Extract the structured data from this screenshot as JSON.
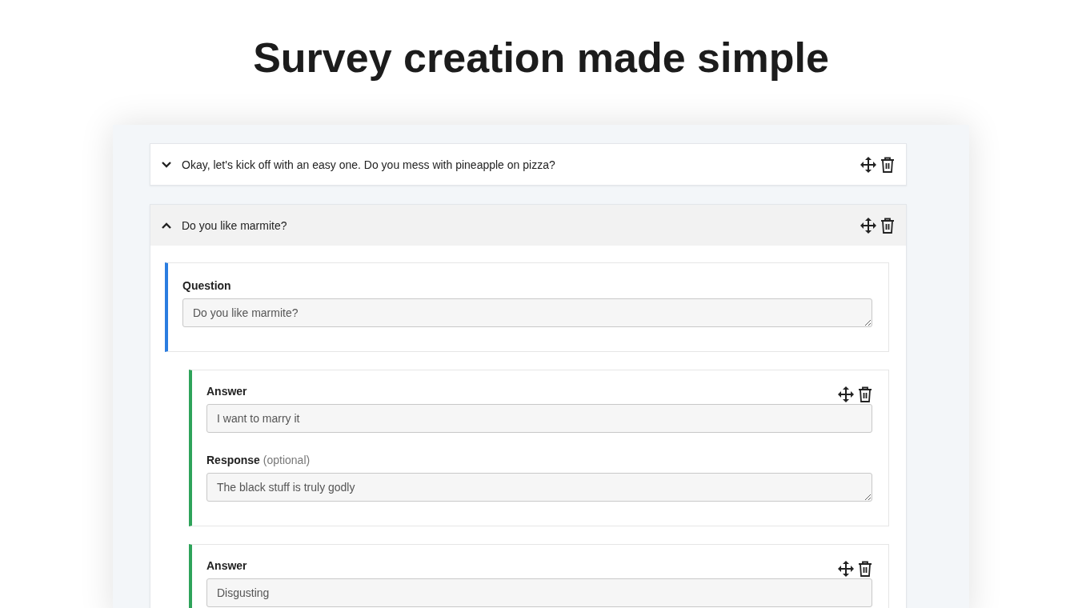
{
  "heading": "Survey creation made simple",
  "questions": [
    {
      "title": "Okay, let's kick off with an easy one. Do you mess with pineapple on pizza?",
      "expanded": false
    },
    {
      "title": "Do you like marmite?",
      "expanded": true,
      "question": {
        "label": "Question",
        "value": "Do you like marmite?"
      },
      "answers": [
        {
          "label": "Answer",
          "value": "I want to marry it",
          "response": {
            "label": "Response",
            "hint": "(optional)",
            "value": "The black stuff is truly godly"
          }
        },
        {
          "label": "Answer",
          "value": "Disgusting"
        }
      ]
    }
  ]
}
